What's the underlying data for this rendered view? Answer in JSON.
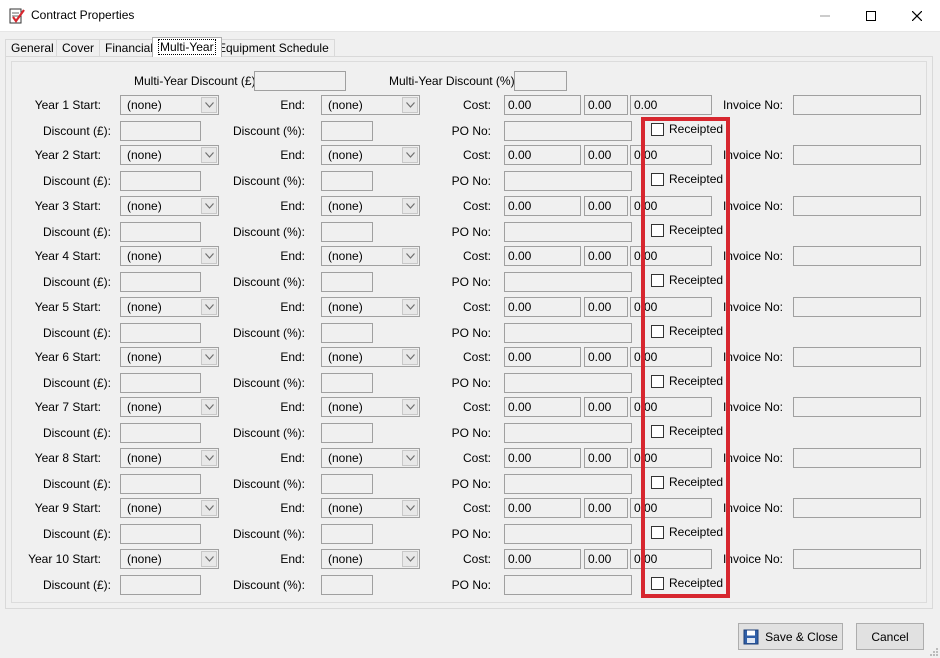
{
  "window": {
    "title": "Contract Properties"
  },
  "tabs": [
    {
      "label": "General",
      "active": false
    },
    {
      "label": "Cover",
      "active": false
    },
    {
      "label": "Financial",
      "active": false
    },
    {
      "label": "Multi-Year",
      "active": true
    },
    {
      "label": "Equipment Schedule",
      "active": false
    }
  ],
  "header": {
    "discount_gbp_label": "Multi-Year Discount (£):",
    "discount_gbp_value": "",
    "discount_pct_label": "Multi-Year Discount (%):",
    "discount_pct_value": ""
  },
  "labels": {
    "end": "End:",
    "cost": "Cost:",
    "invoice": "Invoice No:",
    "discount_gbp": "Discount (£):",
    "discount_pct": "Discount (%):",
    "po": "PO No:",
    "receipted": "Receipted"
  },
  "years": [
    {
      "start_label": "Year 1 Start:",
      "start": "(none)",
      "end": "(none)",
      "cost1": "0.00",
      "cost2": "0.00",
      "cost3": "0.00",
      "invoice": "",
      "discount_gbp": "",
      "discount_pct": "",
      "po": "",
      "receipted": false
    },
    {
      "start_label": "Year 2 Start:",
      "start": "(none)",
      "end": "(none)",
      "cost1": "0.00",
      "cost2": "0.00",
      "cost3": "0.00",
      "invoice": "",
      "discount_gbp": "",
      "discount_pct": "",
      "po": "",
      "receipted": false
    },
    {
      "start_label": "Year 3 Start:",
      "start": "(none)",
      "end": "(none)",
      "cost1": "0.00",
      "cost2": "0.00",
      "cost3": "0.00",
      "invoice": "",
      "discount_gbp": "",
      "discount_pct": "",
      "po": "",
      "receipted": false
    },
    {
      "start_label": "Year 4 Start:",
      "start": "(none)",
      "end": "(none)",
      "cost1": "0.00",
      "cost2": "0.00",
      "cost3": "0.00",
      "invoice": "",
      "discount_gbp": "",
      "discount_pct": "",
      "po": "",
      "receipted": false
    },
    {
      "start_label": "Year 5 Start:",
      "start": "(none)",
      "end": "(none)",
      "cost1": "0.00",
      "cost2": "0.00",
      "cost3": "0.00",
      "invoice": "",
      "discount_gbp": "",
      "discount_pct": "",
      "po": "",
      "receipted": false
    },
    {
      "start_label": "Year 6 Start:",
      "start": "(none)",
      "end": "(none)",
      "cost1": "0.00",
      "cost2": "0.00",
      "cost3": "0.00",
      "invoice": "",
      "discount_gbp": "",
      "discount_pct": "",
      "po": "",
      "receipted": false
    },
    {
      "start_label": "Year 7 Start:",
      "start": "(none)",
      "end": "(none)",
      "cost1": "0.00",
      "cost2": "0.00",
      "cost3": "0.00",
      "invoice": "",
      "discount_gbp": "",
      "discount_pct": "",
      "po": "",
      "receipted": false
    },
    {
      "start_label": "Year 8 Start:",
      "start": "(none)",
      "end": "(none)",
      "cost1": "0.00",
      "cost2": "0.00",
      "cost3": "0.00",
      "invoice": "",
      "discount_gbp": "",
      "discount_pct": "",
      "po": "",
      "receipted": false
    },
    {
      "start_label": "Year 9 Start:",
      "start": "(none)",
      "end": "(none)",
      "cost1": "0.00",
      "cost2": "0.00",
      "cost3": "0.00",
      "invoice": "",
      "discount_gbp": "",
      "discount_pct": "",
      "po": "",
      "receipted": false
    },
    {
      "start_label": "Year 10 Start:",
      "start": "(none)",
      "end": "(none)",
      "cost1": "0.00",
      "cost2": "0.00",
      "cost3": "0.00",
      "invoice": "",
      "discount_gbp": "",
      "discount_pct": "",
      "po": "",
      "receipted": false
    }
  ],
  "footer": {
    "save_label": "Save & Close",
    "cancel_label": "Cancel"
  },
  "colors": {
    "highlight": "#d7272f"
  },
  "icons": {
    "app": "contract-check-icon",
    "save": "floppy-disk-icon"
  }
}
